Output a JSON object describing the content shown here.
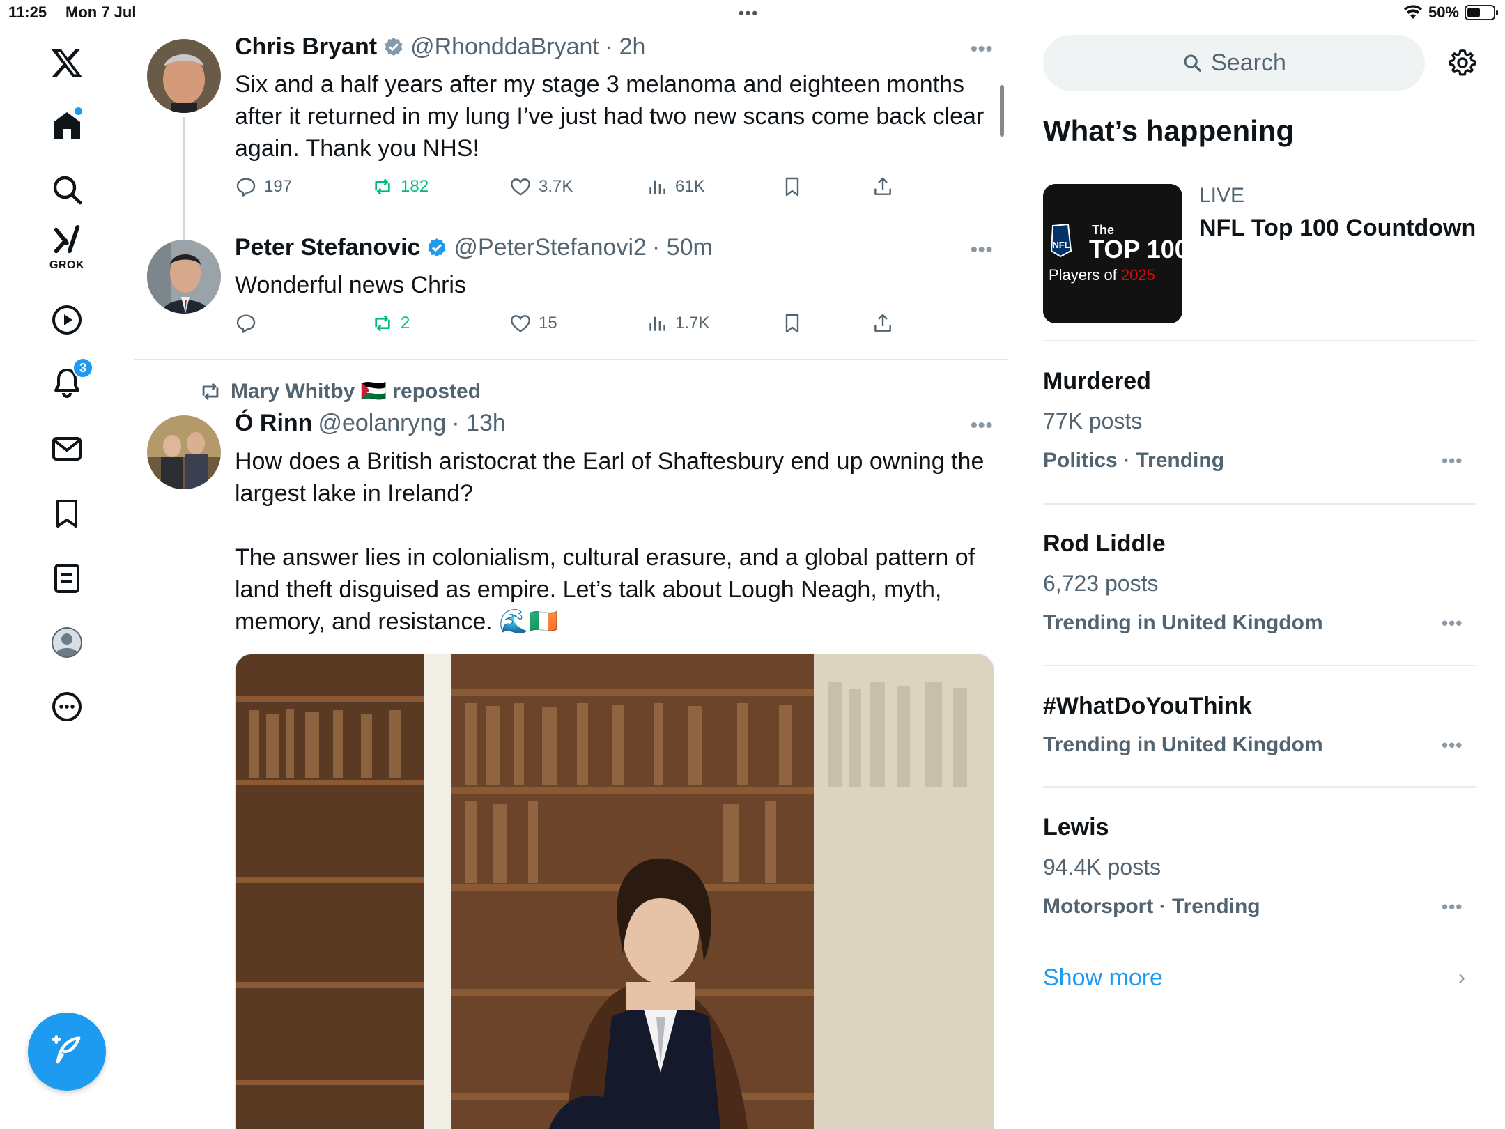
{
  "status_bar": {
    "time": "11:25",
    "date": "Mon 7 Jul",
    "battery": "50%",
    "battery_level": 0.5
  },
  "nav": {
    "grok_label": "GROK",
    "notifications_count": "3"
  },
  "tweets": [
    {
      "name": "Chris Bryant",
      "handle": "@RhonddaBryant",
      "time": "· 2h",
      "text": "Six and a half years after my stage 3 melanoma and eighteen months after it returned in my lung I’ve just had two new scans come back clear again. Thank you NHS!",
      "replies": "197",
      "reposts": "182",
      "likes": "3.7K",
      "views": "61K"
    },
    {
      "name": "Peter Stefanovic",
      "handle": "@PeterStefanovi2",
      "time": "· 50m",
      "text": "Wonderful news Chris",
      "replies": "",
      "reposts": "2",
      "likes": "15",
      "views": "1.7K"
    },
    {
      "reposted_by": "Mary Whitby 🇵🇸 reposted",
      "name": "Ó Rinn",
      "handle": "@eolanryng",
      "time": "· 13h",
      "text": "How does a British aristocrat the Earl of Shaftesbury end up owning the largest lake in Ireland?\n\nThe answer lies in colonialism, cultural erasure, and a global pattern of land theft disguised as empire. Let’s talk about Lough Neagh, myth, memory, and resistance. 🌊🇮🇪"
    }
  ],
  "right": {
    "search_placeholder": "Search",
    "section_title": "What’s happening",
    "live": {
      "label": "LIVE",
      "title": "NFL Top 100 Countdown",
      "thumb_line1": "The",
      "thumb_line2": "TOP 100",
      "thumb_line3": "Players of ",
      "thumb_year": "2025",
      "thumb_logo": "NFL"
    },
    "trends": [
      {
        "title": "Murdered",
        "posts": "77K posts",
        "meta": "Politics · Trending"
      },
      {
        "title": "Rod Liddle",
        "posts": "6,723 posts",
        "meta": "Trending in United Kingdom"
      },
      {
        "title": "#WhatDoYouThink",
        "posts": "",
        "meta": "Trending in United Kingdom"
      },
      {
        "title": "Lewis",
        "posts": "94.4K posts",
        "meta": "Motorsport · Trending"
      }
    ],
    "show_more": "Show more"
  },
  "colors": {
    "accent": "#1d9bf0",
    "repost_green": "#00ba7c",
    "text_secondary": "#536471"
  }
}
